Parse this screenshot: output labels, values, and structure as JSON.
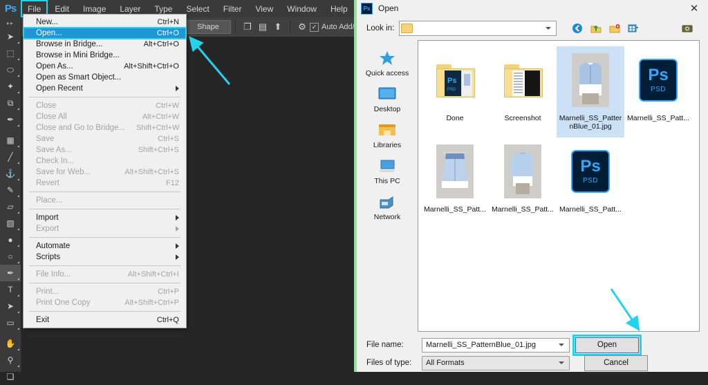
{
  "app": {
    "logo": "Ps",
    "canvas_color": "#262626",
    "accent_highlight": "#22d3ee",
    "menu_highlight": "#2196d6"
  },
  "menubar": {
    "items": [
      {
        "label": "File",
        "highlighted": true
      },
      {
        "label": "Edit"
      },
      {
        "label": "Image"
      },
      {
        "label": "Layer"
      },
      {
        "label": "Type"
      },
      {
        "label": "Select"
      },
      {
        "label": "Filter"
      },
      {
        "label": "View"
      },
      {
        "label": "Window"
      },
      {
        "label": "Help"
      }
    ]
  },
  "options_bar": {
    "shape_dropdown": "Shape",
    "auto_add_delete_label": "Auto Add/Delete",
    "auto_add_delete_checked": true,
    "check_glyph": "✓",
    "icons": [
      {
        "name": "path-operations-icon",
        "glyph": "❐"
      },
      {
        "name": "path-alignment-icon",
        "glyph": "▤"
      },
      {
        "name": "path-arrangement-icon",
        "glyph": "⬆"
      },
      {
        "name": "geometry-options-gear-icon",
        "glyph": "⚙"
      }
    ]
  },
  "toolbar": {
    "handle_glyph": "▸▸",
    "tools": [
      {
        "name": "move-tool",
        "glyph": "➤",
        "selected": false
      },
      {
        "name": "rectangular-marquee-tool",
        "glyph": "⬚",
        "selected": false
      },
      {
        "name": "lasso-tool",
        "glyph": "⬭",
        "selected": false
      },
      {
        "name": "quick-selection-tool",
        "glyph": "✦",
        "selected": false
      },
      {
        "name": "crop-tool",
        "glyph": "⧉",
        "selected": false
      },
      {
        "name": "eyedropper-tool",
        "glyph": "✒",
        "selected": false
      },
      {
        "name": "spot-healing-brush-tool",
        "glyph": "▦",
        "selected": false
      },
      {
        "name": "brush-tool",
        "glyph": "╱",
        "selected": false
      },
      {
        "name": "clone-stamp-tool",
        "glyph": "⚓",
        "selected": false
      },
      {
        "name": "history-brush-tool",
        "glyph": "✎",
        "selected": false
      },
      {
        "name": "eraser-tool",
        "glyph": "▱",
        "selected": false
      },
      {
        "name": "gradient-tool",
        "glyph": "▧",
        "selected": false
      },
      {
        "name": "blur-tool",
        "glyph": "●",
        "selected": false
      },
      {
        "name": "dodge-tool",
        "glyph": "○",
        "selected": false
      },
      {
        "name": "pen-tool",
        "glyph": "✒",
        "selected": true
      },
      {
        "name": "horizontal-type-tool",
        "glyph": "T",
        "selected": false
      },
      {
        "name": "path-selection-tool",
        "glyph": "➤",
        "selected": false
      },
      {
        "name": "rectangle-tool",
        "glyph": "▭",
        "selected": false
      },
      {
        "name": "hand-tool",
        "glyph": "✋",
        "selected": false
      },
      {
        "name": "zoom-tool",
        "glyph": "⚲",
        "selected": false
      }
    ],
    "footer": [
      {
        "name": "foreground-background-color-swatch",
        "glyph": "❑"
      },
      {
        "name": "reset-colors-icon",
        "glyph": "↰"
      }
    ]
  },
  "file_menu": {
    "rows": [
      {
        "label": "New...",
        "accel": "Ctrl+N",
        "state": "normal"
      },
      {
        "label": "Open...",
        "accel": "Ctrl+O",
        "state": "selected"
      },
      {
        "label": "Browse in Bridge...",
        "accel": "Alt+Ctrl+O",
        "state": "normal"
      },
      {
        "label": "Browse in Mini Bridge...",
        "accel": "",
        "state": "normal"
      },
      {
        "label": "Open As...",
        "accel": "Alt+Shift+Ctrl+O",
        "state": "normal"
      },
      {
        "label": "Open as Smart Object...",
        "accel": "",
        "state": "normal"
      },
      {
        "label": "Open Recent",
        "accel": "",
        "state": "submenu"
      },
      {
        "separator": true
      },
      {
        "label": "Close",
        "accel": "Ctrl+W",
        "state": "disabled"
      },
      {
        "label": "Close All",
        "accel": "Alt+Ctrl+W",
        "state": "disabled"
      },
      {
        "label": "Close and Go to Bridge...",
        "accel": "Shift+Ctrl+W",
        "state": "disabled"
      },
      {
        "label": "Save",
        "accel": "Ctrl+S",
        "state": "disabled"
      },
      {
        "label": "Save As...",
        "accel": "Shift+Ctrl+S",
        "state": "disabled"
      },
      {
        "label": "Check In...",
        "accel": "",
        "state": "disabled"
      },
      {
        "label": "Save for Web...",
        "accel": "Alt+Shift+Ctrl+S",
        "state": "disabled"
      },
      {
        "label": "Revert",
        "accel": "F12",
        "state": "disabled"
      },
      {
        "separator": true
      },
      {
        "label": "Place...",
        "accel": "",
        "state": "disabled"
      },
      {
        "separator": true
      },
      {
        "label": "Import",
        "accel": "",
        "state": "submenu"
      },
      {
        "label": "Export",
        "accel": "",
        "state": "disabled-submenu"
      },
      {
        "separator": true
      },
      {
        "label": "Automate",
        "accel": "",
        "state": "submenu"
      },
      {
        "label": "Scripts",
        "accel": "",
        "state": "submenu"
      },
      {
        "separator": true
      },
      {
        "label": "File Info...",
        "accel": "Alt+Shift+Ctrl+I",
        "state": "disabled"
      },
      {
        "separator": true
      },
      {
        "label": "Print...",
        "accel": "Ctrl+P",
        "state": "disabled"
      },
      {
        "label": "Print One Copy",
        "accel": "Alt+Shift+Ctrl+P",
        "state": "disabled"
      },
      {
        "separator": true
      },
      {
        "label": "Exit",
        "accel": "Ctrl+Q",
        "state": "normal"
      }
    ]
  },
  "open_dialog": {
    "app_icon_text": "Ps",
    "title": "Open",
    "close_glyph": "✕",
    "look_in_label": "Look in:",
    "look_in_value": "",
    "toolbar_icons": [
      {
        "name": "back-navigation-icon",
        "glyph": "◀"
      },
      {
        "name": "up-one-level-icon",
        "glyph": "⬆"
      },
      {
        "name": "new-folder-icon",
        "glyph": "➕"
      },
      {
        "name": "view-mode-icon",
        "glyph": "▦"
      },
      {
        "name": "preview-camera-icon",
        "glyph": "▣"
      }
    ],
    "places": [
      {
        "name": "quick-access",
        "label": "Quick access",
        "glyph": "★",
        "color": "#2f9fe0"
      },
      {
        "name": "desktop",
        "label": "Desktop",
        "glyph": "▬",
        "color": "#3a96dd"
      },
      {
        "name": "libraries",
        "label": "Libraries",
        "glyph": "▰",
        "color": "#e8b33c"
      },
      {
        "name": "this-pc",
        "label": "This PC",
        "glyph": "▭",
        "color": "#4a9fe0"
      },
      {
        "name": "network",
        "label": "Network",
        "glyph": "❐",
        "color": "#4b8fc4"
      }
    ],
    "files": [
      {
        "label": "Done",
        "kind": "folder",
        "selected": false
      },
      {
        "label": "Screenshot",
        "kind": "folder",
        "selected": false
      },
      {
        "label": "Marnelli_SS_PatternBlue_01.jpg",
        "kind": "photo-shirt-front",
        "selected": true
      },
      {
        "label": "Marnelli_SS_Patt...",
        "kind": "psd",
        "selected": false
      },
      {
        "label": "Marnelli_SS_Patt...",
        "kind": "photo-shirt-hanger",
        "selected": false
      },
      {
        "label": "Marnelli_SS_Patt...",
        "kind": "photo-shirt-back",
        "selected": false
      },
      {
        "label": "Marnelli_SS_Patt...",
        "kind": "psd",
        "selected": false
      }
    ],
    "psd_tile": {
      "ps_text": "Ps",
      "psd_text": "PSD"
    },
    "file_name_label": "File name:",
    "file_name_value": "Marnelli_SS_PatternBlue_01.jpg",
    "files_of_type_label": "Files of type:",
    "files_of_type_value": "All Formats",
    "open_button": "Open",
    "cancel_button": "Cancel"
  },
  "annotations": {
    "arrow_color": "#22d3ee",
    "arrow_to_open_menu": "points to Open... menu item",
    "arrow_to_open_button": "points to Open button"
  }
}
